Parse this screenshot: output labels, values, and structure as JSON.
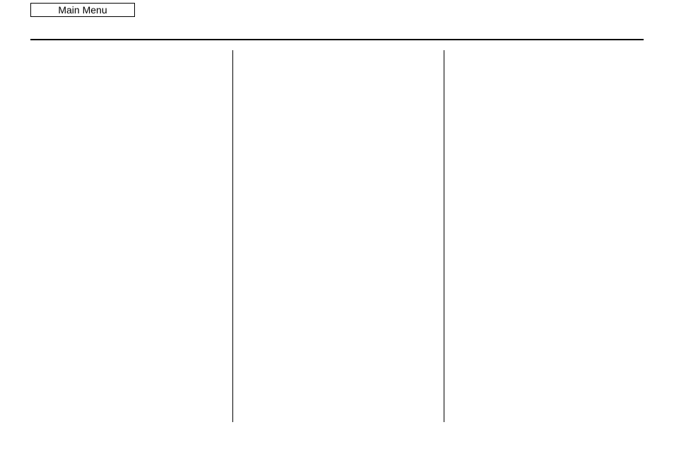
{
  "header": {
    "main_menu_label": "Main Menu"
  }
}
